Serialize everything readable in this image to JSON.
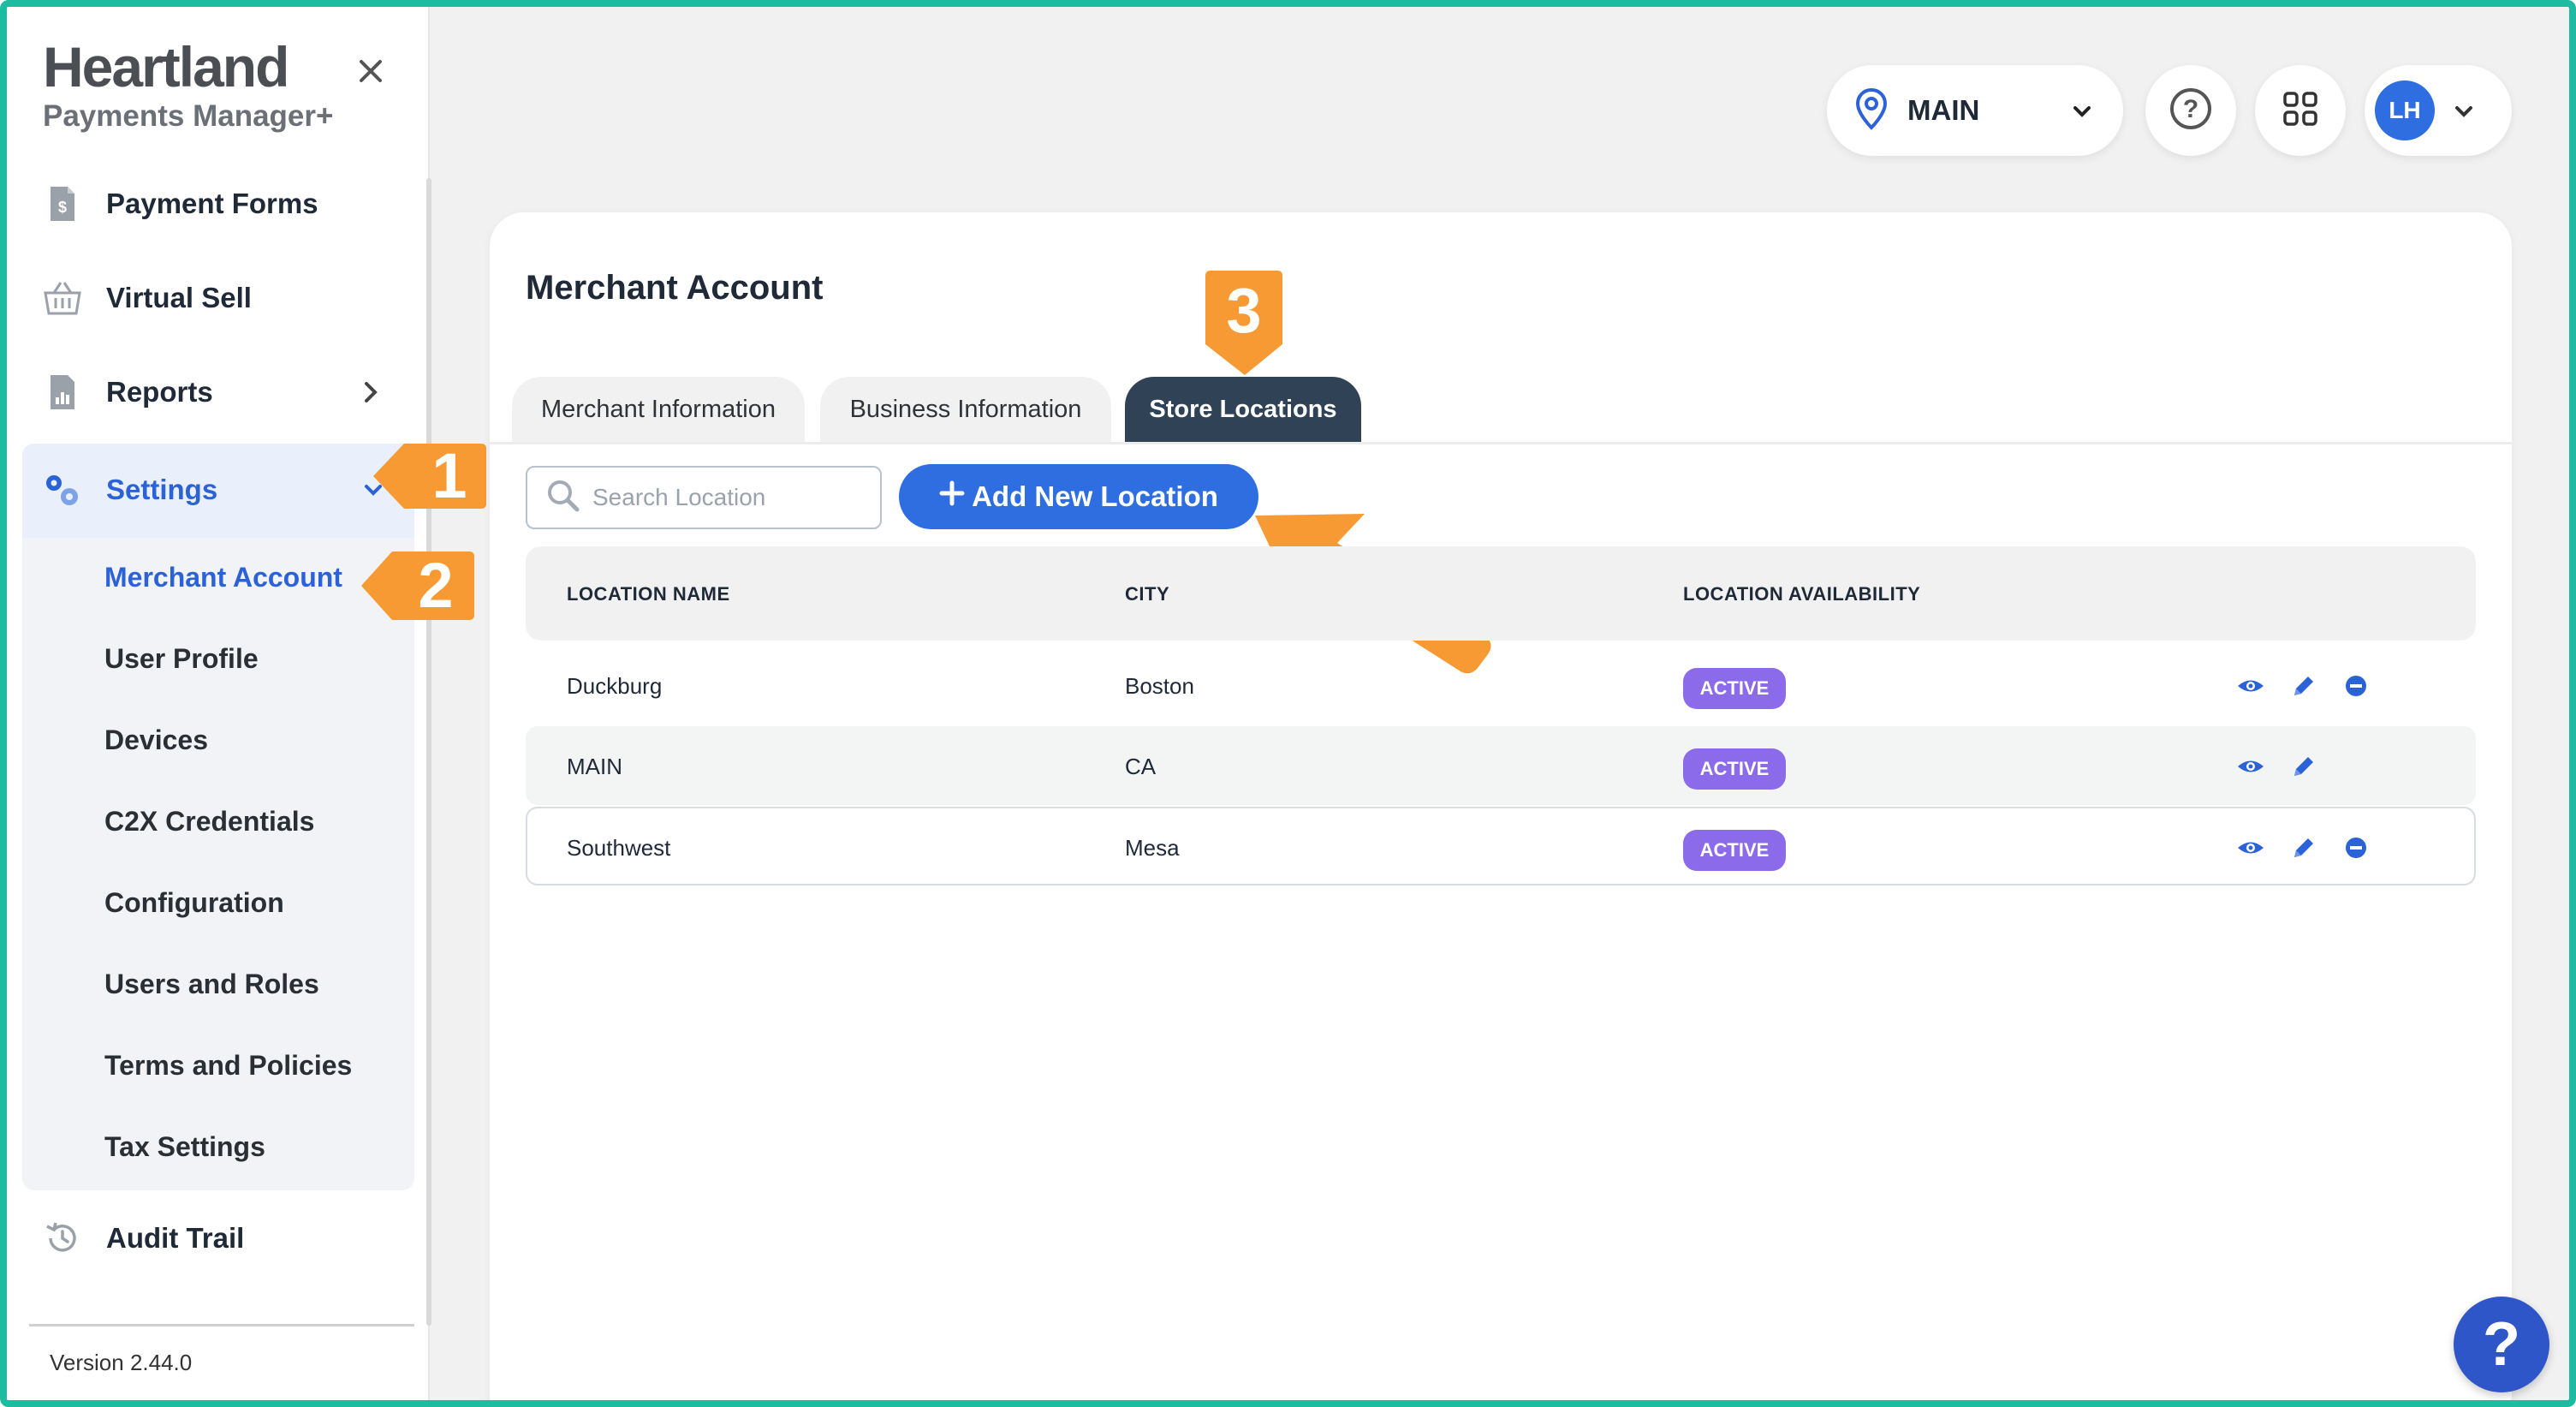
{
  "brand": {
    "name": "Heartland",
    "subtitle": "Payments Manager+"
  },
  "sidebar": {
    "items": [
      {
        "label": "Payment Forms",
        "icon": "document-dollar-icon"
      },
      {
        "label": "Virtual Sell",
        "icon": "basket-icon"
      },
      {
        "label": "Reports",
        "icon": "report-icon"
      },
      {
        "label": "Settings",
        "icon": "gears-icon"
      },
      {
        "label": "Audit Trail",
        "icon": "history-icon"
      }
    ],
    "settings_sub": [
      "Merchant Account",
      "User Profile",
      "Devices",
      "C2X Credentials",
      "Configuration",
      "Users and Roles",
      "Terms and Policies",
      "Tax Settings"
    ],
    "version": "Version 2.44.0"
  },
  "topbar": {
    "location": "MAIN",
    "user_initials": "LH"
  },
  "callouts": {
    "one": "1",
    "two": "2",
    "three": "3"
  },
  "page": {
    "title": "Merchant Account",
    "tabs": [
      "Merchant Information",
      "Business Information",
      "Store Locations"
    ],
    "search_placeholder": "Search Location",
    "add_button": "Add New Location",
    "columns": [
      "LOCATION NAME",
      "CITY",
      "LOCATION AVAILABILITY"
    ],
    "rows": [
      {
        "name": "Duckburg",
        "city": "Boston",
        "status": "ACTIVE"
      },
      {
        "name": "MAIN",
        "city": "CA",
        "status": "ACTIVE"
      },
      {
        "name": "Southwest",
        "city": "Mesa",
        "status": "ACTIVE"
      }
    ]
  },
  "help_fab": "?",
  "colors": {
    "accent": "#2f6ee0",
    "callout": "#f79a33",
    "tab_active": "#2f4256",
    "status": "#8c6bea",
    "frame": "#1dbb9f"
  }
}
